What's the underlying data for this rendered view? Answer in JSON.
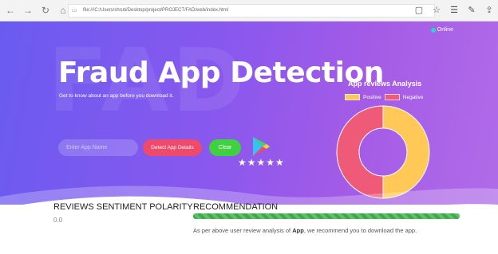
{
  "browser": {
    "url": "file:///C:/Users/shruti/Desktop/project/PROJECT/FAD/web/index.html"
  },
  "status": {
    "online_label": "Online"
  },
  "hero": {
    "background_text": "FAD",
    "title": "Fraud App Detection",
    "subtitle": "Get to know about an app before you download it.",
    "input_placeholder": "Enter App Name",
    "detect_label": "Detect App Details",
    "clear_label": "Clear",
    "stars": "★★★★★"
  },
  "chart": {
    "title": "App reviews Analysis",
    "positive_label": "Positive",
    "negative_label": "Negative"
  },
  "chart_data": {
    "type": "pie",
    "title": "App reviews Analysis",
    "categories": [
      "Positive",
      "Negative"
    ],
    "values": [
      50,
      50
    ],
    "colors": [
      "#ffc857",
      "#ef5a78"
    ],
    "donut": true,
    "legend": "top"
  },
  "sentiment": {
    "heading": "REVIEWS SENTIMENT POLARITY",
    "value": "0.0"
  },
  "recommendation": {
    "heading": "RECOMMENDATION",
    "text_before": "As per above user review analysis of",
    "app_name": "App",
    "text_after": ", we recommend you to download the app."
  }
}
